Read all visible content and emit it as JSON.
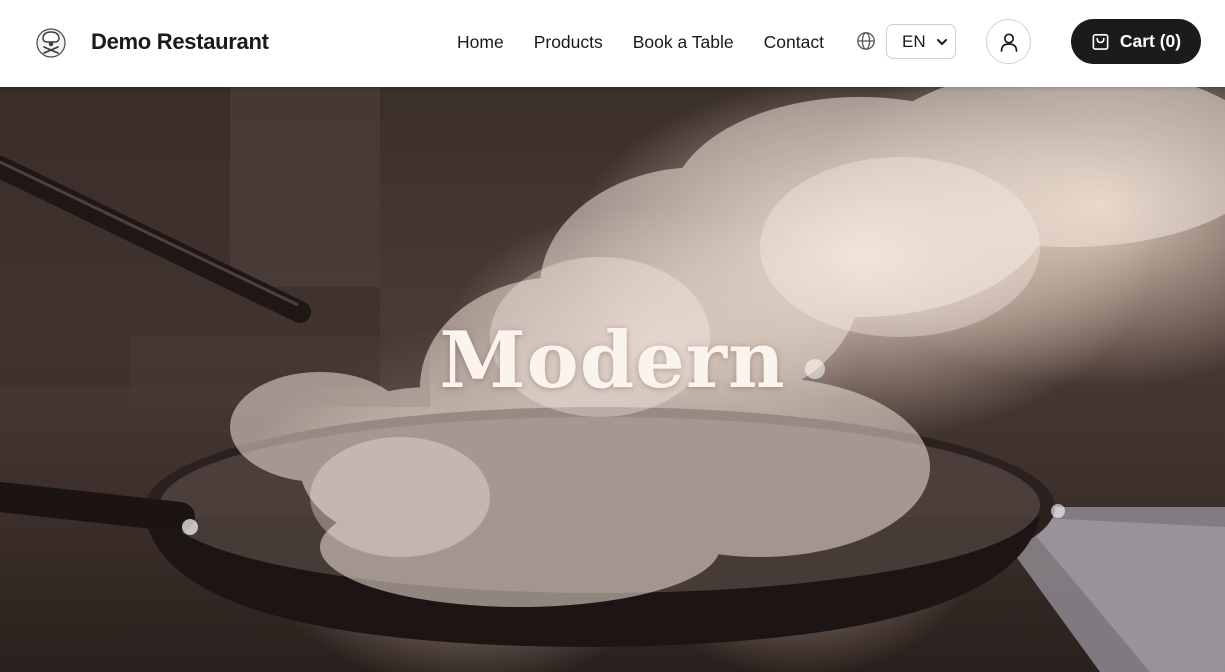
{
  "header": {
    "brand_name": "Demo Restaurant",
    "logo_icon": "chef-hat-logo-icon",
    "nav_items": [
      "Home",
      "Products",
      "Book a Table",
      "Contact"
    ],
    "language_icon": "globe-icon",
    "language_selected": "EN",
    "account_icon": "user-icon",
    "cart_icon": "shopping-bag-icon",
    "cart_label": "Cart (0)"
  },
  "hero": {
    "title": "Modern",
    "image": "steaming-frying-pan-photo"
  },
  "colors": {
    "header_bg": "#ffffff",
    "cart_button_bg": "#1b1b1b",
    "hero_text": "#fbf4ee"
  }
}
